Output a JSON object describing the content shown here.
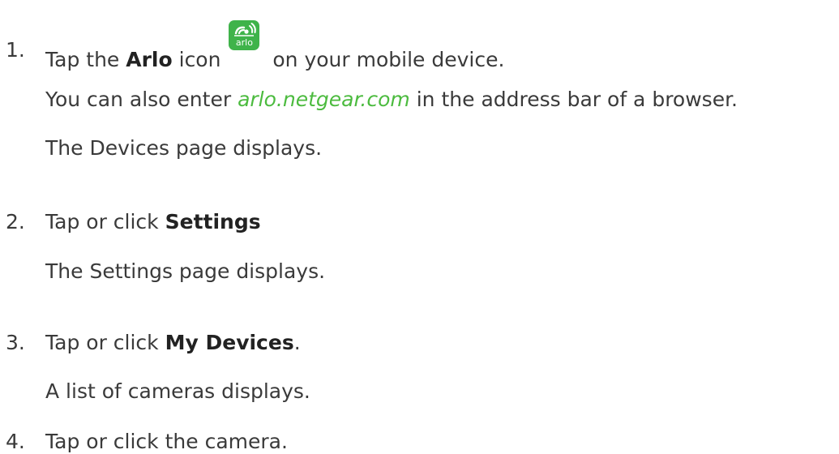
{
  "steps": [
    {
      "number": "1.",
      "pre": "Tap the ",
      "bold": "Arlo",
      "mid": " icon",
      "post": " on your mobile device.",
      "icon": {
        "name": "arlo-app-icon",
        "label": "arlo",
        "color": "#3fb34a"
      },
      "notes": [
        {
          "pre": "You can also enter ",
          "link": "arlo.netgear.com",
          "post": " in the address bar of a browser."
        },
        {
          "text": "The Devices page displays."
        }
      ]
    },
    {
      "number": "2.",
      "pre": "Tap or click ",
      "bold": "Settings",
      "post": "",
      "notes": [
        {
          "text": "The Settings page displays."
        }
      ]
    },
    {
      "number": "3.",
      "pre": "Tap or click ",
      "bold": "My Devices",
      "post": ".",
      "notes": [
        {
          "text": "A list of cameras displays."
        }
      ]
    },
    {
      "number": "4.",
      "pre": "Tap or click the camera.",
      "bold": "",
      "post": "",
      "notes": []
    }
  ],
  "colors": {
    "text": "#3a3a3a",
    "link": "#4cbb3f",
    "icon_bg": "#3fb34a"
  }
}
